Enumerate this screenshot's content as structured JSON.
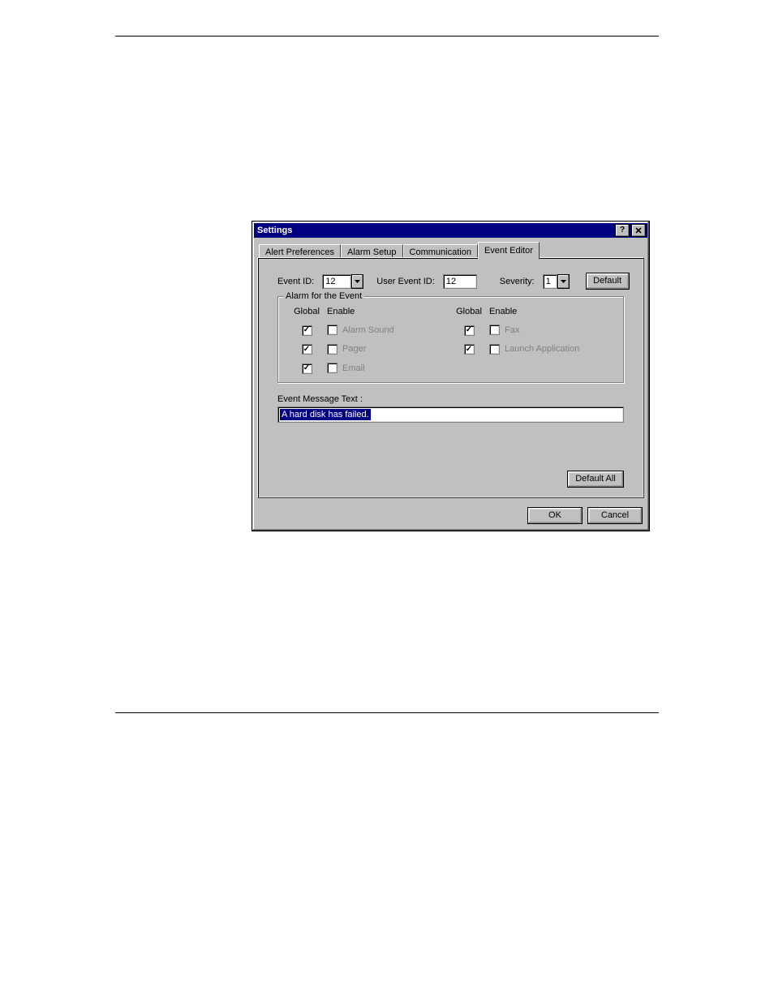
{
  "window": {
    "title": "Settings",
    "help_tooltip": "?",
    "close_tooltip": "x"
  },
  "tabs": {
    "alert_preferences": "Alert Preferences",
    "alarm_setup": "Alarm Setup",
    "communication": "Communication",
    "event_editor": "Event Editor"
  },
  "form": {
    "event_id_label": "Event ID:",
    "event_id_value": "12",
    "user_event_id_label": "User Event ID:",
    "user_event_id_value": "12",
    "severity_label": "Severity:",
    "severity_value": "1",
    "default_btn": "Default"
  },
  "group": {
    "legend": "Alarm for the Event",
    "col_global": "Global",
    "col_enable": "Enable",
    "alarm_sound": "Alarm Sound",
    "pager": "Pager",
    "email": "Email",
    "fax": "Fax",
    "launch_app": "Launch Application"
  },
  "message": {
    "label": "Event Message Text :",
    "value": "A hard disk has failed."
  },
  "buttons": {
    "default_all": "Default All",
    "ok": "OK",
    "cancel": "Cancel"
  }
}
